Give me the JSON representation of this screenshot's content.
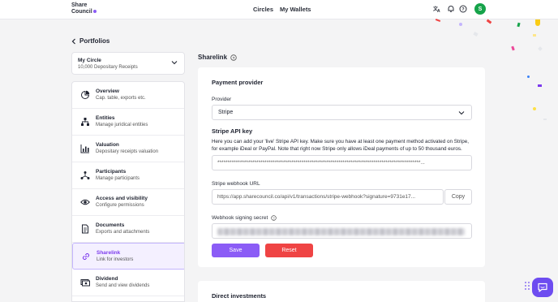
{
  "header": {
    "logo_line1": "Share",
    "logo_line2": "Council",
    "nav": [
      "Circles",
      "My Wallets"
    ],
    "avatar_letter": "S",
    "colors": {
      "accent": "#8b5cf6",
      "avatar": "#16a34a"
    }
  },
  "back": {
    "label": "Portfolios"
  },
  "circle": {
    "name": "My Circle",
    "subtitle": "10,000 Depositary Receipts"
  },
  "sidebar": {
    "items": [
      {
        "label": "Overview",
        "sub": "Cap. table, exports etc.",
        "icon": "pie-chart-icon"
      },
      {
        "label": "Entities",
        "sub": "Manage juridical entities",
        "icon": "org-chart-icon"
      },
      {
        "label": "Valuation",
        "sub": "Depositary receipts valuation",
        "icon": "bar-chart-icon"
      },
      {
        "label": "Participants",
        "sub": "Manage participants",
        "icon": "network-icon"
      },
      {
        "label": "Access and visibility",
        "sub": "Configure permissions",
        "icon": "eye-icon"
      },
      {
        "label": "Documents",
        "sub": "Exports and attachments",
        "icon": "document-icon"
      },
      {
        "label": "Sharelink",
        "sub": "Link for investors",
        "icon": "link-icon"
      },
      {
        "label": "Dividend",
        "sub": "Send and view dividends",
        "icon": "money-icon"
      }
    ],
    "active_index": 6
  },
  "page": {
    "title": "Sharelink",
    "payment": {
      "heading": "Payment provider",
      "provider_label": "Provider",
      "provider_value": "Stripe",
      "api_key_heading": "Stripe API key",
      "api_key_desc": "Here you can add your 'live' Stripe API key. Make sure you have at least one payment method activated on Stripe, for example iDeal or PayPal. Note that right now Stripe only allows iDeal payments of up to 50 thousand euros.",
      "api_key_value": "***************************************************************************************************...",
      "webhook_label": "Stripe webhook URL",
      "webhook_value": "https://app.sharecouncil.co/api/v1/transactions/stripe-webhook?signature=9731e17...",
      "copy_label": "Copy",
      "signing_label": "Webhook signing secret",
      "save_label": "Save",
      "reset_label": "Reset",
      "colors": {
        "save": "#8b5cf6",
        "reset": "#ef4444"
      }
    },
    "direct": {
      "heading": "Direct investments"
    }
  }
}
